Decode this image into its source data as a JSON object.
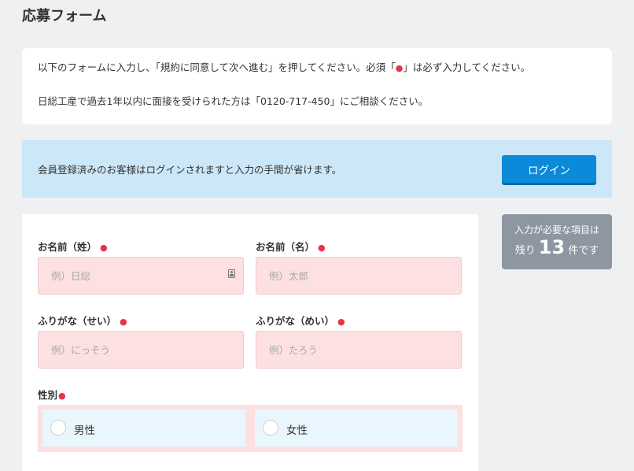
{
  "page": {
    "title": "応募フォーム"
  },
  "notice": {
    "line1_before": "以下のフォームに入力し、「規約に同意して次へ進む」を押してください。必須「",
    "line1_dot": "●",
    "line1_after": "」は必ず入力してください。",
    "line2": "日総工産で過去1年以内に面接を受けられた方は「0120-717-450」にご相談ください。"
  },
  "login": {
    "message": "会員登録済みのお客様はログインされますと入力の手間が省けます。",
    "button_label": "ログイン"
  },
  "form": {
    "required_mark": "●",
    "last_name": {
      "label": "お名前（姓）",
      "placeholder": "例）日総",
      "value": ""
    },
    "first_name": {
      "label": "お名前（名）",
      "placeholder": "例）太郎",
      "value": ""
    },
    "last_kana": {
      "label": "ふりがな（せい）",
      "placeholder": "例）にっそう",
      "value": ""
    },
    "first_kana": {
      "label": "ふりがな（めい）",
      "placeholder": "例）たろう",
      "value": ""
    },
    "gender": {
      "label": "性別",
      "options": [
        "男性",
        "女性"
      ]
    }
  },
  "remaining": {
    "top_text": "入力が必要な項目は",
    "prefix": "残り",
    "count": "13",
    "suffix": "件です"
  },
  "colors": {
    "accent": "#0a8ad8",
    "required": "#e8334a",
    "input_bg": "#fde0e2",
    "login_bg": "#cce7f7",
    "badge_bg": "#8d96a1"
  }
}
